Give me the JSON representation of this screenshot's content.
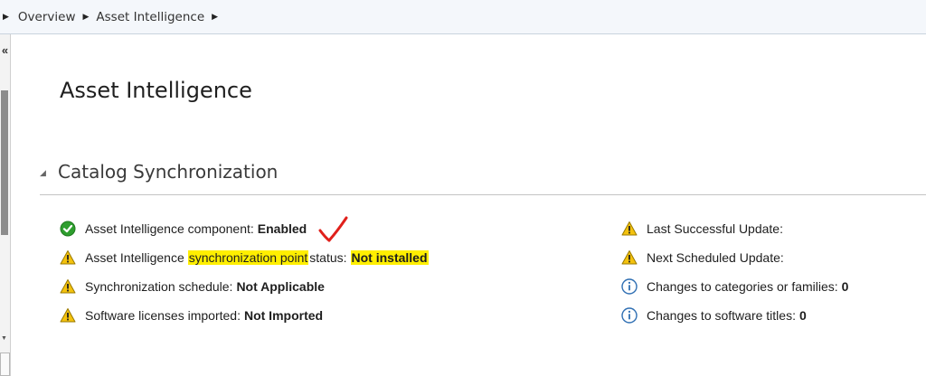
{
  "breadcrumb": {
    "items": [
      "Overview",
      "Asset Intelligence"
    ],
    "separator": "▶"
  },
  "nav": {
    "collapse_glyph": "«"
  },
  "page": {
    "title": "Asset Intelligence"
  },
  "section": {
    "title": "Catalog Synchronization"
  },
  "left_status": [
    {
      "icon": "check-icon",
      "label": "Asset Intelligence component:",
      "value": "Enabled"
    },
    {
      "icon": "warning-icon",
      "label_before": "Asset Intelligence",
      "label_highlight": "synchronization point",
      "label_after": "status:",
      "value": "Not installed"
    },
    {
      "icon": "warning-icon",
      "label": "Synchronization schedule:",
      "value": "Not Applicable"
    },
    {
      "icon": "warning-icon",
      "label": "Software licenses imported:",
      "value": "Not Imported"
    }
  ],
  "right_status": [
    {
      "icon": "warning-icon",
      "label": "Last Successful Update:",
      "value": ""
    },
    {
      "icon": "warning-icon",
      "label": "Next Scheduled Update:",
      "value": ""
    },
    {
      "icon": "info-icon",
      "label": "Changes to categories or families:",
      "value": "0"
    },
    {
      "icon": "info-icon",
      "label": "Changes to software titles:",
      "value": "0"
    }
  ],
  "colors": {
    "highlight": "#ffef00",
    "check_green": "#2e9e2e",
    "warning_yellow": "#f4c20d",
    "info_blue": "#2f6fb3",
    "annotation_red": "#e0201b"
  }
}
